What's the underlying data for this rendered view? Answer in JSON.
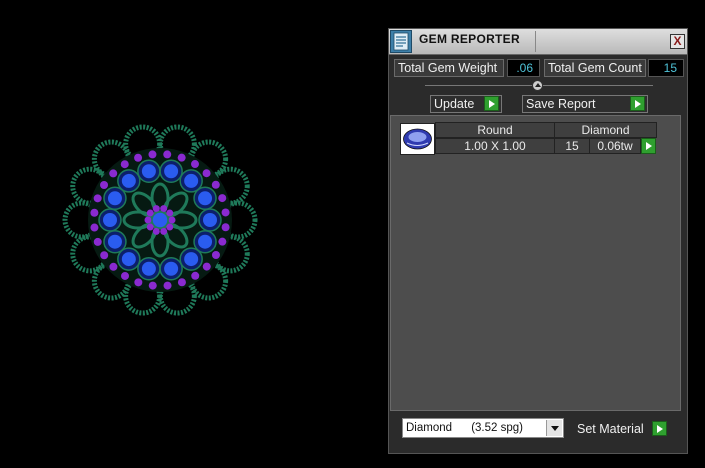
{
  "window": {
    "title": "GEM REPORTER",
    "close_glyph": "X"
  },
  "totals": {
    "weight_label": "Total Gem Weight",
    "weight_value": ".06",
    "count_label": "Total Gem Count",
    "count_value": "15"
  },
  "actions": {
    "update_label": "Update",
    "save_report_label": "Save Report",
    "set_material_label": "Set Material"
  },
  "gem_list": {
    "rows": [
      {
        "shape": "Round",
        "material": "Diamond",
        "size": "1.00 X 1.00",
        "count": "15",
        "weight": "0.06tw",
        "thumbnail_icon": "round-gem-icon"
      }
    ]
  },
  "material_select": {
    "value": "Diamond      (3.52 spg)"
  },
  "icons": {
    "app": "gem-reporter-app-icon",
    "close": "close-icon",
    "play": "play-arrow-icon",
    "dropdown": "chevron-down-icon"
  },
  "colors": {
    "value_text": "#4fc3d8",
    "play_button": "#2fa02f",
    "panel_background": "#2b2b2b",
    "list_background": "#4d4d4d",
    "jewel_metal": "#1f7a5a",
    "jewel_large_stones": "#2a5cf0",
    "jewel_small_stones": "#8a2ad0"
  }
}
